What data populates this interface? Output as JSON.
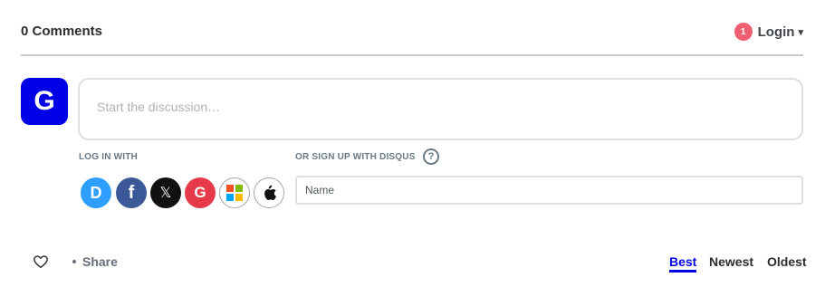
{
  "header": {
    "comment_count": "0 Comments",
    "notification_count": "1",
    "login_label": "Login",
    "caret": "▾"
  },
  "user": {
    "avatar_letter": "G",
    "avatar_color": "#0000e6"
  },
  "composer": {
    "placeholder": "Start the discussion…"
  },
  "login": {
    "label": "LOG IN WITH",
    "providers": [
      {
        "name": "Disqus",
        "icon": "disqus-icon",
        "glyph": "D",
        "color": "#2e9fff"
      },
      {
        "name": "Facebook",
        "icon": "facebook-icon",
        "glyph": "f",
        "color": "#3b5998"
      },
      {
        "name": "X",
        "icon": "x-icon",
        "glyph": "𝕏",
        "color": "#111111"
      },
      {
        "name": "Google",
        "icon": "google-icon",
        "glyph": "G",
        "color": "#e63a4a"
      },
      {
        "name": "Microsoft",
        "icon": "microsoft-icon"
      },
      {
        "name": "Apple",
        "icon": "apple-icon"
      }
    ]
  },
  "signup": {
    "label": "OR SIGN UP WITH DISQUS",
    "help_glyph": "?",
    "name_placeholder": "Name"
  },
  "actions": {
    "share_label": "Share"
  },
  "sort": {
    "options": [
      "Best",
      "Newest",
      "Oldest"
    ],
    "selected": "Best"
  },
  "colors": {
    "accent": "#0000e6",
    "notification": "#f05f70"
  }
}
